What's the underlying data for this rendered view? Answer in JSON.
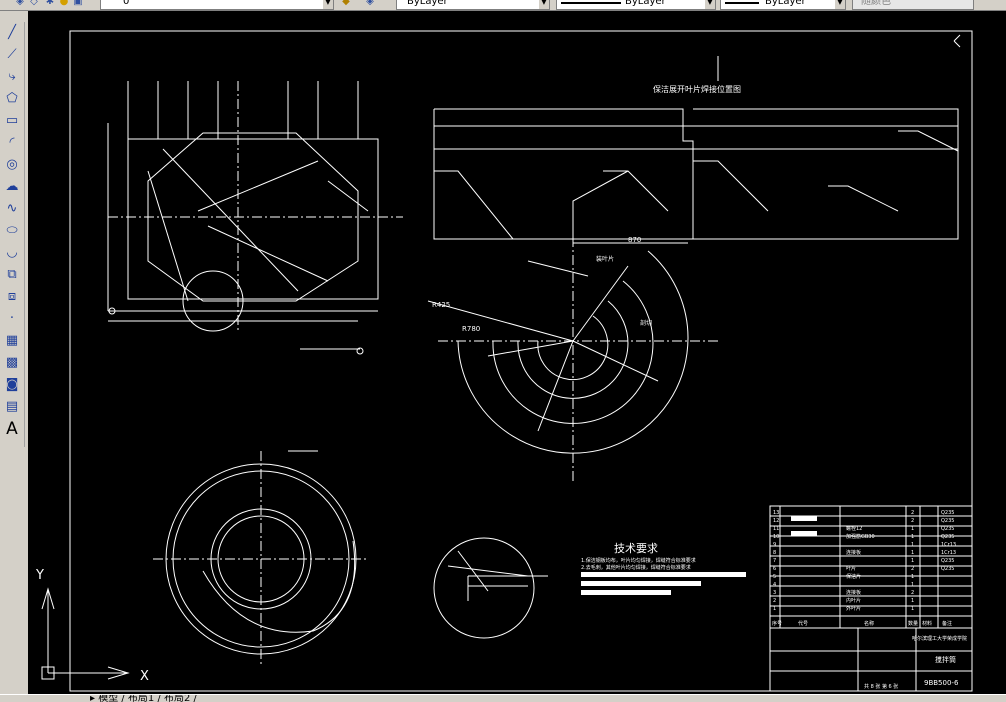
{
  "toolbar": {
    "layer_value": "0",
    "color_value": "ByLayer",
    "linetype_value": "ByLayer",
    "lineweight_value": "ByLayer",
    "plotstyle_value": "随颜色",
    "icons": [
      "layer-manager-icon",
      "layer-state-icon",
      "sun-icon",
      "freeze-icon",
      "lock-icon",
      "color-icon",
      "layer-previous-icon",
      "match-layer-icon"
    ]
  },
  "left_tools": [
    "line-icon",
    "construction-line-icon",
    "polyline-icon",
    "polygon-icon",
    "rectangle-icon",
    "arc-icon",
    "circle-icon",
    "revision-cloud-icon",
    "spline-icon",
    "ellipse-icon",
    "ellipse-arc-icon",
    "insert-block-icon",
    "make-block-icon",
    "point-icon",
    "hatch-icon",
    "gradient-icon",
    "region-icon",
    "table-icon",
    "multiline-text-icon"
  ],
  "text_tool_label": "A",
  "drawing": {
    "top_view_title": "保洁展开叶片焊接位置图",
    "tech_title": "技术要求",
    "tech_lines": [
      "1.保洁钢板均布，叶片均匀焊接，焊缝符合标准要求",
      "2.去毛刺，其他叶片均匀焊接，焊缝符合标准要求"
    ],
    "dims": {
      "r1": "R425",
      "r2": "R780",
      "d870": "870",
      "label_leaf": "装叶片",
      "label_cut": "剖切"
    },
    "title_block": {
      "school": "哈尔滨理工大学荣成学院",
      "part_name": "搅拌筒",
      "drawing_no": "9BB500-6",
      "scale_row": "共 8 张 第 6 张",
      "header_cols": [
        "序号",
        "代号",
        "名称",
        "数量",
        "材料",
        "备注"
      ],
      "materials": [
        "Q235",
        "Q235",
        "Q235",
        "Q235",
        "1Cr13",
        "1Cr13",
        "Q235",
        "Q235",
        "",
        "",
        "",
        "",
        ""
      ],
      "qty": [
        "2",
        "2",
        "1",
        "1",
        "1",
        "1",
        "1",
        "2",
        "1",
        "1",
        "2",
        "1",
        "1"
      ],
      "names": [
        "",
        "",
        "螺栓12",
        "加强筋GB30",
        "",
        "连接板",
        "",
        "叶片",
        "保洁片",
        "",
        "连接板",
        "内叶片",
        "外叶片"
      ]
    }
  },
  "axes": {
    "x_label": "X",
    "y_label": "Y"
  },
  "status": {
    "text": "▸ 模型 / 布局1 / 布局2 /"
  },
  "colors": {
    "canvas": "#000000",
    "lines": "#ffffff",
    "chrome": "#d4d0c8"
  }
}
